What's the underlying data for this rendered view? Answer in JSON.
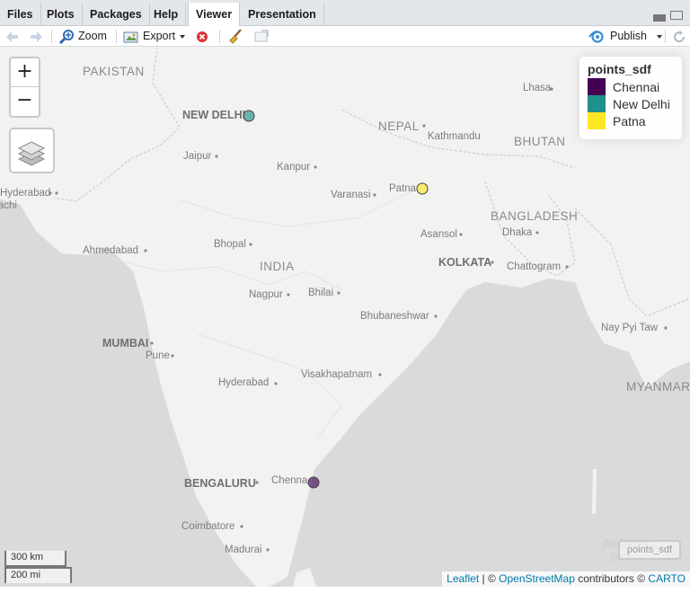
{
  "tabs": [
    {
      "label": "Files",
      "active": false
    },
    {
      "label": "Plots",
      "active": false
    },
    {
      "label": "Packages",
      "active": false
    },
    {
      "label": "Help",
      "active": false
    },
    {
      "label": "Viewer",
      "active": true
    },
    {
      "label": "Presentation",
      "active": false
    }
  ],
  "toolbar": {
    "zoom_label": "Zoom",
    "export_label": "Export",
    "publish_label": "Publish"
  },
  "map": {
    "zoom_in": "+",
    "zoom_out": "−",
    "labels": {
      "pakistan": "PAKISTAN",
      "nepal": "NEPAL",
      "bhutan": "BHUTAN",
      "bangladesh": "BANGLADESH",
      "india": "INDIA",
      "myanmar": "MYANMAR",
      "lhasa": "Lhasa",
      "kathmandu": "Kathmandu",
      "new_delhi": "NEW DELHI",
      "jaipur": "Jaipur",
      "kanpur": "Kanpur",
      "varanasi": "Varanasi",
      "patna": "Patna",
      "hyderabad_pk": "Hyderabad",
      "karachi": "rachi",
      "ahmedabad": "Ahmedabad",
      "bhopal": "Bhopal",
      "asansol": "Asansol",
      "dhaka": "Dhaka",
      "kolkata": "KOLKATA",
      "chattogram": "Chattogram",
      "nagpur": "Nagpur",
      "bhilai": "Bhilai",
      "bhubaneshwar": "Bhubaneshwar",
      "mumbai": "MUMBAI",
      "pune": "Pune",
      "nay_pyi_taw": "Nay Pyi Taw",
      "hyderabad": "Hyderabad",
      "visakhapatnam": "Visakhapatnam",
      "bengaluru": "BENGALURU",
      "chennai": "Chenna",
      "coimbatore": "Coimbatore",
      "madurai": "Madurai",
      "andaman": "Andaman",
      "sea": "Sea"
    },
    "points": [
      {
        "name": "Chennai",
        "color": "#440154"
      },
      {
        "name": "New Delhi",
        "color": "#21908C"
      },
      {
        "name": "Patna",
        "color": "#FDE725"
      }
    ],
    "legend": {
      "title": "points_sdf",
      "items": [
        {
          "label": "Chennai",
          "color": "#440154"
        },
        {
          "label": "New Delhi",
          "color": "#21908C"
        },
        {
          "label": "Patna",
          "color": "#FDE725"
        }
      ]
    },
    "layer_control_label": "points_sdf",
    "scale": {
      "km": "300 km",
      "mi": "200 mi"
    },
    "attribution": {
      "leaflet": "Leaflet",
      "sep": " | © ",
      "osm": "OpenStreetMap",
      "contributors": " contributors © ",
      "carto": "CARTO"
    }
  }
}
